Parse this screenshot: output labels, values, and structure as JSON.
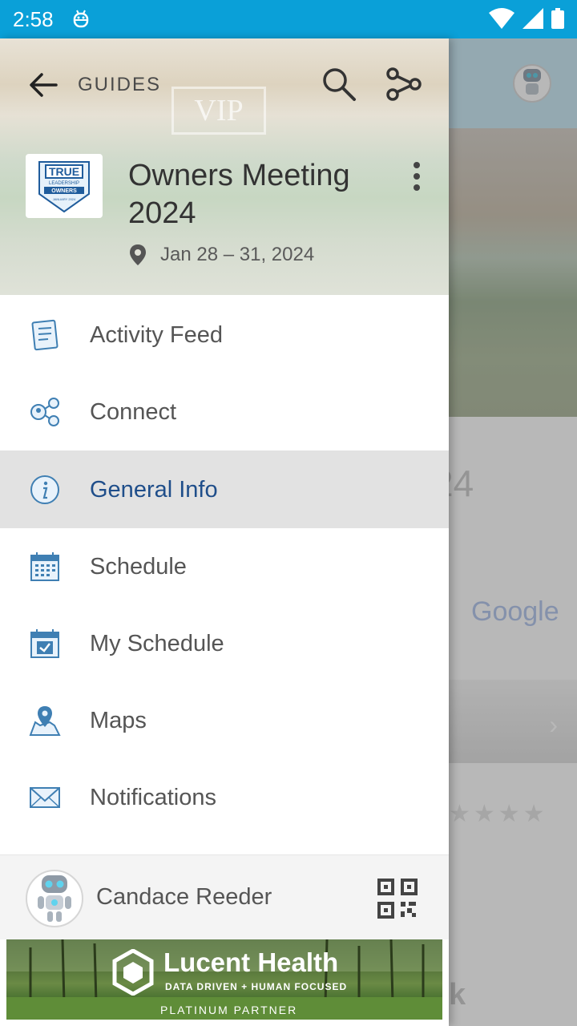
{
  "status_bar": {
    "time": "2:58"
  },
  "drawer": {
    "header": {
      "back_label": "GUIDES",
      "event_title": "Owners Meeting 2024",
      "event_dates": "Jan 28 – 31, 2024",
      "logo_text": "TRUE",
      "logo_sub": "LEADERSHIP",
      "logo_band": "OWNERS",
      "logo_date": "JANUARY 2024"
    },
    "menu": [
      {
        "label": "Activity Feed",
        "icon": "activity-feed-icon",
        "active": false
      },
      {
        "label": "Connect",
        "icon": "connect-icon",
        "active": false
      },
      {
        "label": "General Info",
        "icon": "info-icon",
        "active": true
      },
      {
        "label": "Schedule",
        "icon": "calendar-icon",
        "active": false
      },
      {
        "label": "My Schedule",
        "icon": "calendar-check-icon",
        "active": false
      },
      {
        "label": "Maps",
        "icon": "map-pin-icon",
        "active": false
      },
      {
        "label": "Notifications",
        "icon": "envelope-icon",
        "active": false
      }
    ],
    "user": {
      "name": "Candace Reeder"
    },
    "sponsor": {
      "brand": "Lucent Health",
      "tagline": "DATA DRIVEN + HUMAN FOCUSED",
      "level": "PLATINUM PARTNER"
    }
  },
  "background": {
    "year_fragment": "24",
    "google_label": "Google",
    "k_fragment": "k"
  },
  "colors": {
    "status_bar": "#0aa0d8",
    "active_item_bg": "#e2e2e2",
    "active_item_text": "#1f4e8a",
    "icon_blue": "#3f7fb3"
  }
}
